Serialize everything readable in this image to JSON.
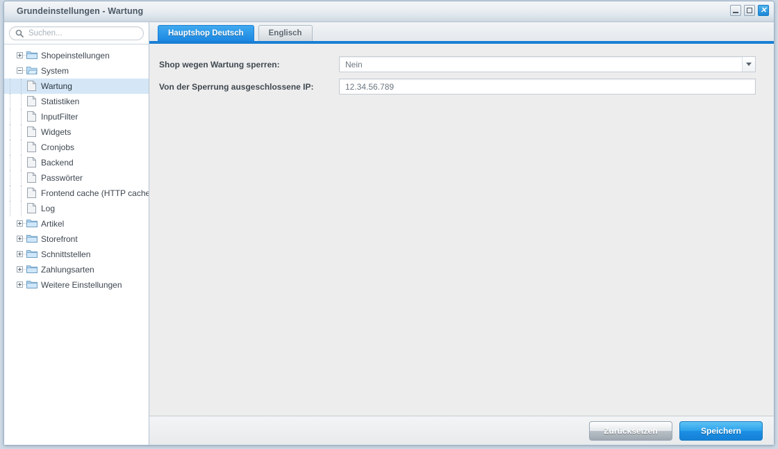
{
  "window": {
    "title": "Grundeinstellungen - Wartung",
    "controls": [
      {
        "name": "minimize-button",
        "icon": "minimize-icon",
        "label": ""
      },
      {
        "name": "maximize-button",
        "icon": "maximize-icon",
        "label": ""
      },
      {
        "name": "close-button",
        "icon": "close-icon",
        "label": "✕"
      }
    ]
  },
  "sidebar": {
    "search": {
      "placeholder": "Suchen...",
      "value": "",
      "icon": "search-icon"
    },
    "tree": [
      {
        "label": "Shopeinstellungen",
        "level": 0,
        "type": "folder",
        "state": "collapsed",
        "selected": false
      },
      {
        "label": "System",
        "level": 0,
        "type": "folder",
        "state": "expanded",
        "selected": false
      },
      {
        "label": "Wartung",
        "level": 1,
        "type": "leaf",
        "state": "",
        "selected": true
      },
      {
        "label": "Statistiken",
        "level": 1,
        "type": "leaf",
        "state": "",
        "selected": false
      },
      {
        "label": "InputFilter",
        "level": 1,
        "type": "leaf",
        "state": "",
        "selected": false
      },
      {
        "label": "Widgets",
        "level": 1,
        "type": "leaf",
        "state": "",
        "selected": false
      },
      {
        "label": "Cronjobs",
        "level": 1,
        "type": "leaf",
        "state": "",
        "selected": false
      },
      {
        "label": "Backend",
        "level": 1,
        "type": "leaf",
        "state": "",
        "selected": false
      },
      {
        "label": "Passwörter",
        "level": 1,
        "type": "leaf",
        "state": "",
        "selected": false
      },
      {
        "label": "Frontend cache (HTTP cache)",
        "level": 1,
        "type": "leaf",
        "state": "",
        "selected": false
      },
      {
        "label": "Log",
        "level": 1,
        "type": "leaf",
        "state": "",
        "selected": false
      },
      {
        "label": "Artikel",
        "level": 0,
        "type": "folder",
        "state": "collapsed",
        "selected": false
      },
      {
        "label": "Storefront",
        "level": 0,
        "type": "folder",
        "state": "collapsed",
        "selected": false
      },
      {
        "label": "Schnittstellen",
        "level": 0,
        "type": "folder",
        "state": "collapsed",
        "selected": false
      },
      {
        "label": "Zahlungsarten",
        "level": 0,
        "type": "folder",
        "state": "collapsed",
        "selected": false
      },
      {
        "label": "Weitere Einstellungen",
        "level": 0,
        "type": "folder",
        "state": "collapsed",
        "selected": false
      }
    ]
  },
  "content": {
    "tabs": [
      {
        "label": "Hauptshop Deutsch",
        "active": true
      },
      {
        "label": "Englisch",
        "active": false
      }
    ],
    "fields": [
      {
        "label": "Shop wegen Wartung sperren:",
        "kind": "select",
        "value": "Nein",
        "placeholder": "",
        "trigger_icon": "chevron-down-icon"
      },
      {
        "label": "Von der Sperrung ausgeschlossene IP:",
        "kind": "text",
        "value": "12.34.56.789",
        "placeholder": ""
      }
    ]
  },
  "footer": {
    "reset_label": "Zurücksetzen",
    "save_label": "Speichern"
  },
  "colors": {
    "accent": "#1a7fd4",
    "tab_active_top": "#3fa9ef",
    "tab_active_bottom": "#1c88e2",
    "selection": "#d5e7f7",
    "panel_bg": "#ededed",
    "title_text": "#4a5866"
  }
}
